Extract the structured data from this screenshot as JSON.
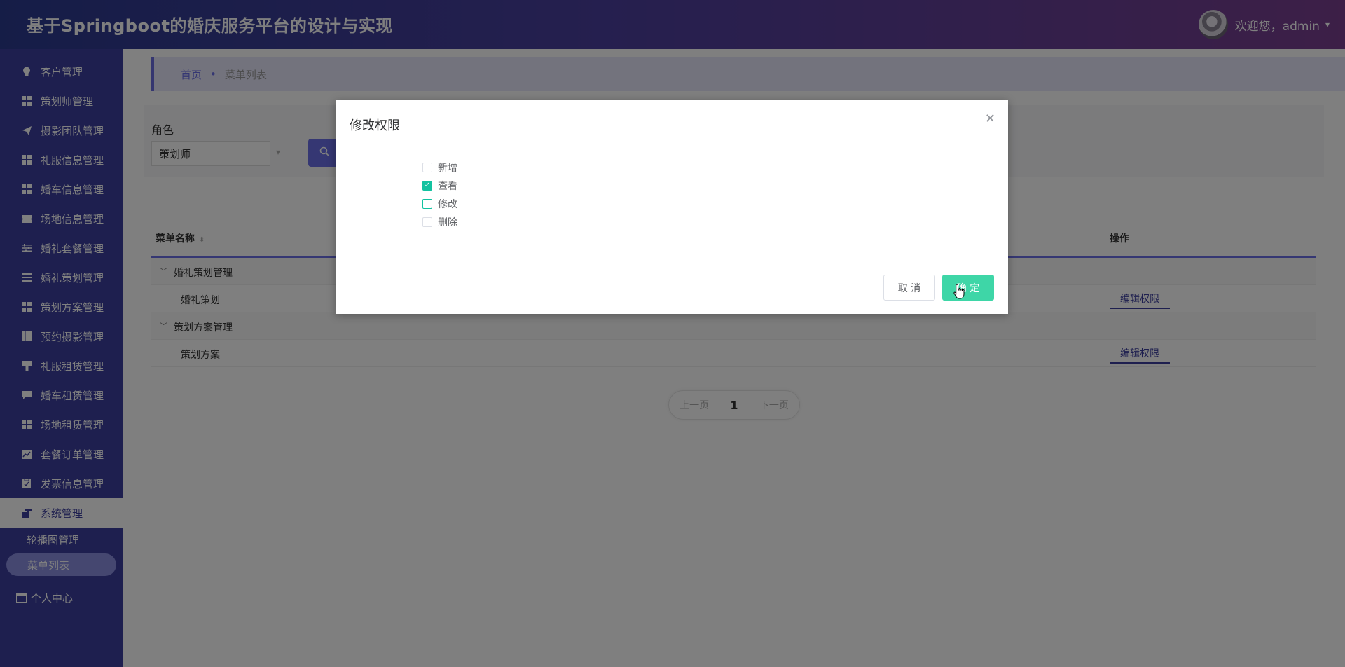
{
  "header": {
    "title": "基于Springboot的婚庆服务平台的设计与实现",
    "welcome": "欢迎您，admin"
  },
  "sidebar": {
    "items": [
      {
        "label": "客户管理",
        "icon": "bulb-icon"
      },
      {
        "label": "策划师管理",
        "icon": "grid-icon"
      },
      {
        "label": "摄影团队管理",
        "icon": "paper-plane-icon"
      },
      {
        "label": "礼服信息管理",
        "icon": "grid-icon"
      },
      {
        "label": "婚车信息管理",
        "icon": "grid-icon"
      },
      {
        "label": "场地信息管理",
        "icon": "ticket-icon"
      },
      {
        "label": "婚礼套餐管理",
        "icon": "sliders-icon"
      },
      {
        "label": "婚礼策划管理",
        "icon": "list-icon"
      },
      {
        "label": "策划方案管理",
        "icon": "grid-icon"
      },
      {
        "label": "预约摄影管理",
        "icon": "book-icon"
      },
      {
        "label": "礼服租赁管理",
        "icon": "stamp-icon"
      },
      {
        "label": "婚车租赁管理",
        "icon": "message-icon"
      },
      {
        "label": "场地租赁管理",
        "icon": "grid-icon"
      },
      {
        "label": "套餐订单管理",
        "icon": "chart-icon"
      },
      {
        "label": "发票信息管理",
        "icon": "clipboard-icon"
      },
      {
        "label": "系统管理",
        "icon": "settings-icon"
      }
    ],
    "sub_items": [
      "轮播图管理",
      "菜单列表"
    ],
    "personal": "个人中心"
  },
  "breadcrumb": {
    "home": "首页",
    "separator": "•",
    "current": "菜单列表"
  },
  "search": {
    "role_label": "角色",
    "role_value": "策划师"
  },
  "table": {
    "headers": {
      "name": "菜单名称",
      "operation": "操作"
    },
    "rows": [
      {
        "name": "婚礼策划管理",
        "type": "group"
      },
      {
        "name": "婚礼策划",
        "type": "child",
        "action": "编辑权限"
      },
      {
        "name": "策划方案管理",
        "type": "group"
      },
      {
        "name": "策划方案",
        "type": "child",
        "action": "编辑权限"
      }
    ]
  },
  "pagination": {
    "prev": "上一页",
    "page": "1",
    "next": "下一页"
  },
  "modal": {
    "title": "修改权限",
    "options": [
      {
        "label": "新增",
        "checked": false
      },
      {
        "label": "查看",
        "checked": true
      },
      {
        "label": "修改",
        "checked": false
      },
      {
        "label": "删除",
        "checked": false
      }
    ],
    "cancel": "取 消",
    "confirm": "确 定"
  },
  "colors": {
    "header_start": "#2b3a8f",
    "sidebar": "#3c3f9e",
    "accent": "#6b6fe6",
    "confirm": "#3ed6a7",
    "checkbox": "#13c2a0"
  }
}
